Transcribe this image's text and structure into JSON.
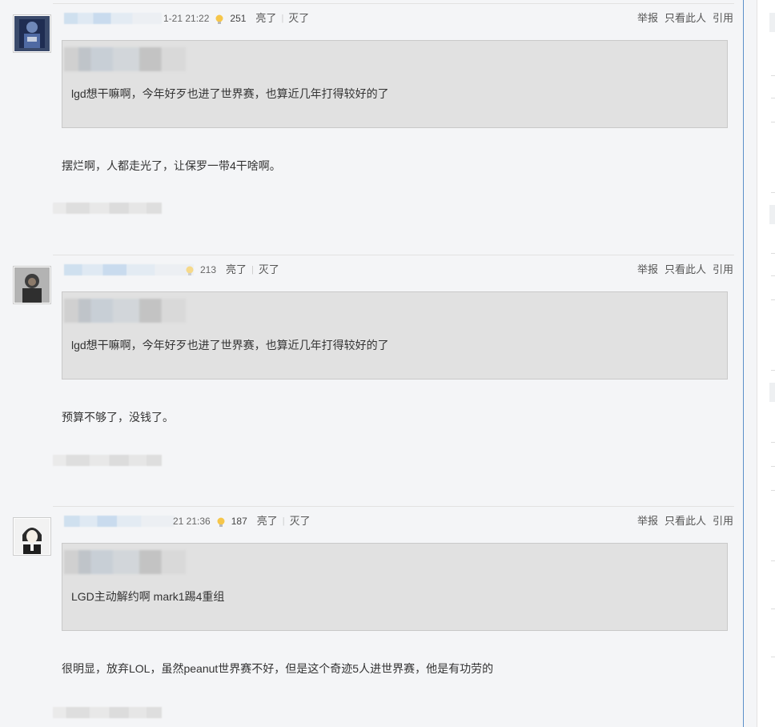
{
  "posts": [
    {
      "time_partial": "1-21 21:22",
      "light_count": "251",
      "like_label": "亮了",
      "dislike_label": "灭了",
      "ops": {
        "report": "举报",
        "only_this": "只看此人",
        "quote": "引用"
      },
      "quote_text": "lgd想干嘛啊，今年好歹也进了世界赛，也算近几年打得较好的了",
      "reply_text": "摆烂啊，人都走光了，让保罗一带4干啥啊。"
    },
    {
      "time_partial": "",
      "light_count": "213",
      "like_label": "亮了",
      "dislike_label": "灭了",
      "ops": {
        "report": "举报",
        "only_this": "只看此人",
        "quote": "引用"
      },
      "quote_text": "lgd想干嘛啊，今年好歹也进了世界赛，也算近几年打得较好的了",
      "reply_text": "预算不够了，没钱了。"
    },
    {
      "time_partial": "21 21:36",
      "light_count": "187",
      "like_label": "亮了",
      "dislike_label": "灭了",
      "ops": {
        "report": "举报",
        "only_this": "只看此人",
        "quote": "引用"
      },
      "quote_text": "LGD主动解约啊 mark1踢4重组",
      "reply_text": "很明显，放弃LOL，虽然peanut世界赛不好，但是这个奇迹5人进世界赛，他是有功劳的"
    }
  ],
  "colors": {
    "accent_border": "#5b8fc9",
    "quote_bg": "#e1e1e1",
    "page_bg": "#f4f5f7"
  },
  "icons": {
    "light": "lightbulb-icon"
  }
}
